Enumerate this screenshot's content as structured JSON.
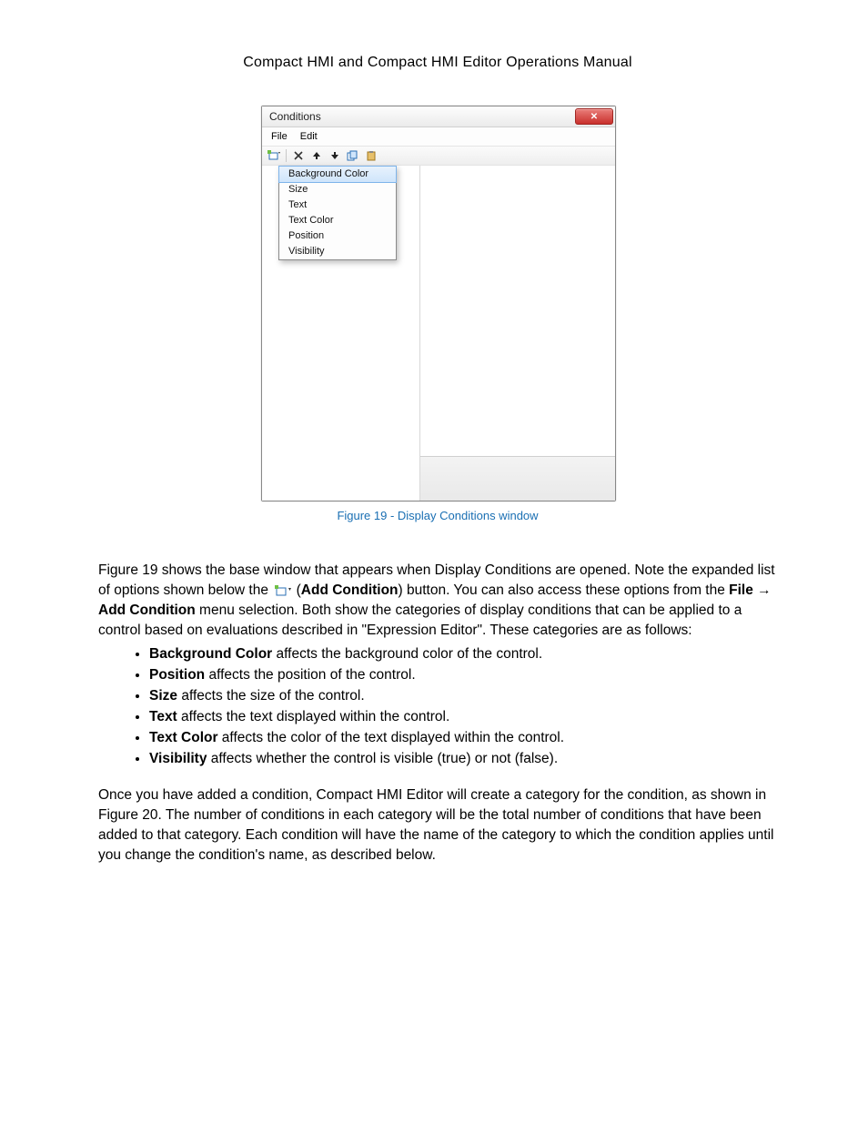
{
  "doc": {
    "title": "Compact HMI and Compact HMI Editor Operations Manual"
  },
  "win": {
    "title": "Conditions",
    "menu": {
      "file": "File",
      "edit": "Edit"
    },
    "dropdown": {
      "items": [
        "Background Color",
        "Size",
        "Text",
        "Text Color",
        "Position",
        "Visibility"
      ]
    }
  },
  "caption": "Figure 19 - Display Conditions window",
  "para1a": "Figure 19 shows the base window that appears when Display Conditions are opened. Note the expanded list of options shown below the ",
  "addcond_label": "Add Condition",
  "para1b": ") button. You can also access these options from the ",
  "file_label": "File",
  "addcond_menu": "Add Condition",
  "para1c": " menu selection. Both show the categories of display conditions that can be applied to a control based on evaluations described in \"Expression Editor\". These categories are as follows:",
  "bullets": [
    {
      "term": "Background Color",
      "rest": " affects the background color of the control."
    },
    {
      "term": "Position",
      "rest": " affects the position of the control."
    },
    {
      "term": "Size",
      "rest": " affects the size of the control."
    },
    {
      "term": "Text",
      "rest": " affects the text displayed within the control."
    },
    {
      "term": "Text Color",
      "rest": " affects the color of the text displayed within the control."
    },
    {
      "term": "Visibility",
      "rest": "  affects whether the control is visible (true) or not (false)."
    }
  ],
  "para2": "Once you have added a condition, Compact HMI Editor will create a category for the condition, as shown in Figure 20. The number of conditions in each category will be the total number of conditions that have been added to that category. Each condition will have the name of the category to which the condition applies until you change the condition's name, as described below."
}
